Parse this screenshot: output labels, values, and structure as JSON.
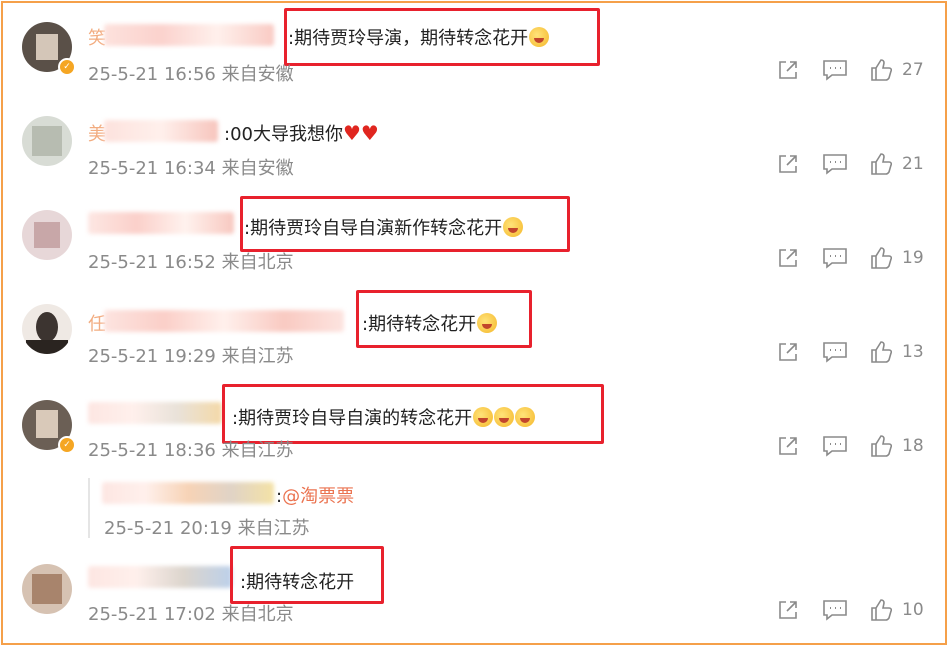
{
  "comments": [
    {
      "text": ":期待贾玲导演，期待转念花开",
      "time": "25-5-21 16:56",
      "location": "来自安徽",
      "likes": "27",
      "name_char": "笑",
      "emojis": 1
    },
    {
      "text": ":00大导我想你",
      "time": "25-5-21 16:34",
      "location": "来自安徽",
      "likes": "21",
      "name_char": "美"
    },
    {
      "text": ":期待贾玲自导自演新作转念花开",
      "time": "25-5-21 16:52",
      "location": "来自北京",
      "likes": "19",
      "emojis": 1
    },
    {
      "text": ":期待转念花开",
      "time": "25-5-21 19:29",
      "location": "来自江苏",
      "likes": "13",
      "name_char": "任",
      "emojis": 1
    },
    {
      "text": ":期待贾玲自导自演的转念花开",
      "time": "25-5-21 18:36",
      "location": "来自江苏",
      "likes": "18",
      "emojis": 3,
      "reply": {
        "prefix": ":",
        "mention": "@淘票票",
        "time": "25-5-21 20:19",
        "location": "来自江苏"
      }
    },
    {
      "text": ":期待转念花开",
      "time": "25-5-21 17:02",
      "location": "来自北京",
      "likes": "10"
    }
  ],
  "icons": {
    "share": "share-icon",
    "comment": "comment-icon",
    "like": "like-icon"
  },
  "colors": {
    "highlight": "#e8212d",
    "frame": "#f5a04a",
    "mention": "#eb7350"
  }
}
